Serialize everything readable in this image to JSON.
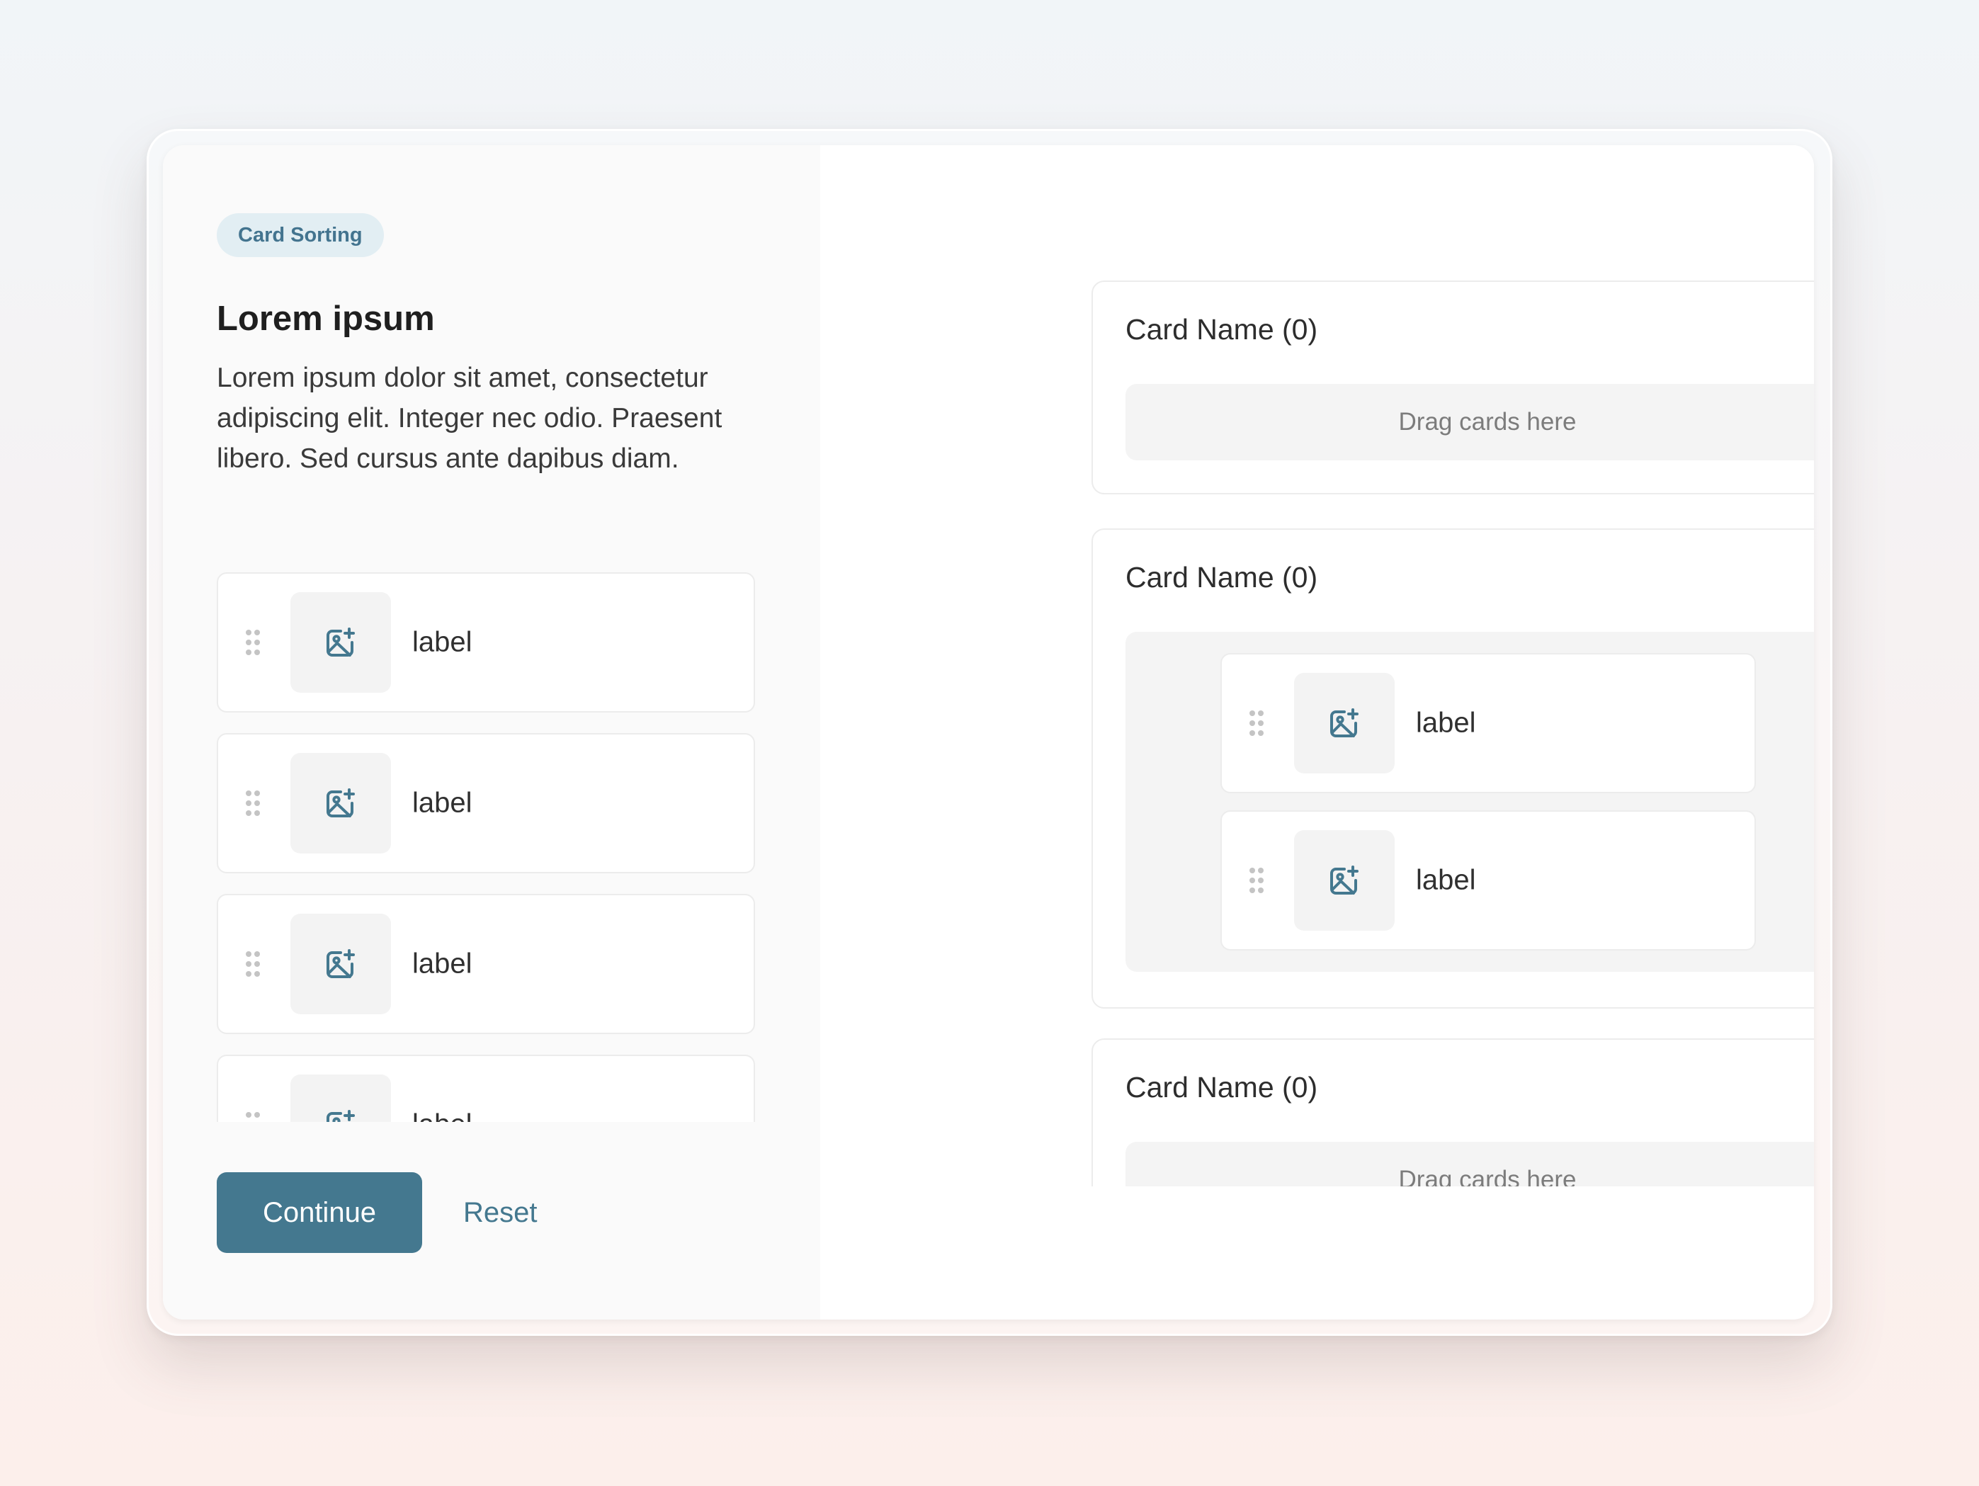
{
  "colors": {
    "accent": "#44788f",
    "badge_bg": "#e2eef3",
    "left_panel_bg": "#fafafa",
    "dropzone_bg": "#f4f4f4"
  },
  "intro": {
    "badge": "Card Sorting",
    "title": "Lorem ipsum",
    "description": "Lorem ipsum dolor sit amet, consectetur adipiscing elit. Integer nec odio. Praesent libero. Sed cursus ante dapibus diam."
  },
  "cards": [
    {
      "label": "label",
      "icon": "image-plus-icon",
      "handle_icon": "drag-handle-icon"
    },
    {
      "label": "label",
      "icon": "image-plus-icon",
      "handle_icon": "drag-handle-icon"
    },
    {
      "label": "label",
      "icon": "image-plus-icon",
      "handle_icon": "drag-handle-icon"
    },
    {
      "label": "label",
      "icon": "image-plus-icon",
      "handle_icon": "drag-handle-icon"
    }
  ],
  "actions": {
    "continue_label": "Continue",
    "reset_label": "Reset"
  },
  "categories": [
    {
      "title": "Card Name (0)",
      "placeholder": "Drag cards here",
      "cards": []
    },
    {
      "title": "Card Name (0)",
      "placeholder": "",
      "cards": [
        {
          "label": "label",
          "icon": "image-plus-icon"
        },
        {
          "label": "label",
          "icon": "image-plus-icon"
        }
      ]
    },
    {
      "title": "Card Name (0)",
      "placeholder": "Drag cards here",
      "cards": []
    }
  ]
}
